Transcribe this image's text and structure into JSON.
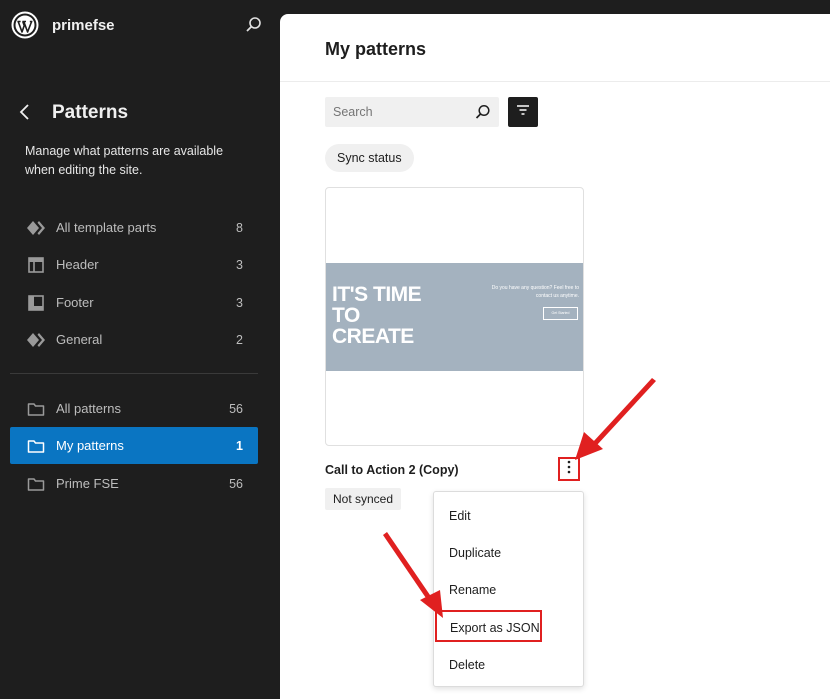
{
  "site": {
    "name": "primefse"
  },
  "sidebar": {
    "title": "Patterns",
    "description": "Manage what patterns are available when editing the site.",
    "template_parts": [
      {
        "label": "All template parts",
        "count": "8",
        "icon": "template-parts-icon"
      },
      {
        "label": "Header",
        "count": "3",
        "icon": "header-icon"
      },
      {
        "label": "Footer",
        "count": "3",
        "icon": "footer-icon"
      },
      {
        "label": "General",
        "count": "2",
        "icon": "template-parts-icon"
      }
    ],
    "categories": [
      {
        "label": "All patterns",
        "count": "56",
        "icon": "folder-icon"
      },
      {
        "label": "My patterns",
        "count": "1",
        "icon": "folder-icon",
        "active": true
      },
      {
        "label": "Prime FSE",
        "count": "56",
        "icon": "folder-icon"
      }
    ]
  },
  "main": {
    "title": "My patterns",
    "search": {
      "placeholder": "Search",
      "value": ""
    },
    "filter_chip": "Sync status",
    "pattern": {
      "title": "Call to Action 2 (Copy)",
      "status": "Not synced",
      "preview": {
        "headline": [
          "IT'S TIME",
          "TO",
          "CREATE"
        ],
        "text": "Do you have any question? Feel free to contact us anytime.",
        "button": "Get Started"
      }
    },
    "actions_menu": {
      "items": [
        "Edit",
        "Duplicate",
        "Rename",
        "Export as JSON",
        "Delete"
      ],
      "highlighted": "Export as JSON"
    }
  },
  "colors": {
    "sidebar_bg": "#1e1e1e",
    "active_item": "#0a75c2",
    "annotation": "#e02020",
    "preview_bg": "#a4b2bf"
  }
}
